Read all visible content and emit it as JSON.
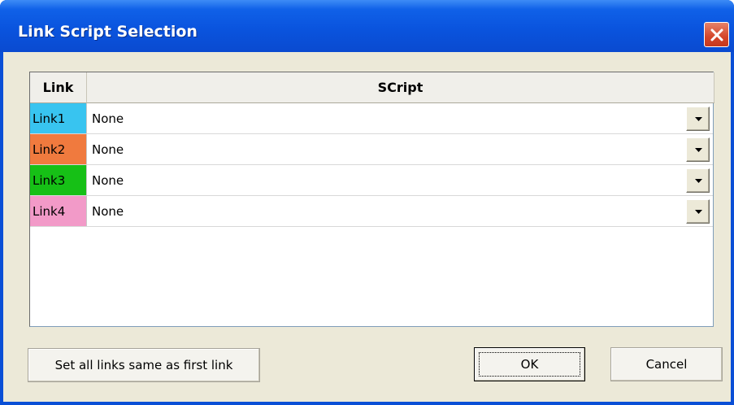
{
  "window": {
    "title": "Link Script Selection"
  },
  "table": {
    "headers": {
      "link": "Link",
      "script": "SCript"
    },
    "rows": [
      {
        "link": "Link1",
        "script": "None",
        "color": "#38c4f0"
      },
      {
        "link": "Link2",
        "script": "None",
        "color": "#f07a3e"
      },
      {
        "link": "Link3",
        "script": "None",
        "color": "#16c016"
      },
      {
        "link": "Link4",
        "script": "None",
        "color": "#f29ac8"
      }
    ]
  },
  "buttons": {
    "set_all": "Set all links same as first link",
    "ok": "OK",
    "cancel": "Cancel"
  },
  "icons": {
    "close": "close-icon",
    "dropdown": "chevron-down-icon"
  }
}
